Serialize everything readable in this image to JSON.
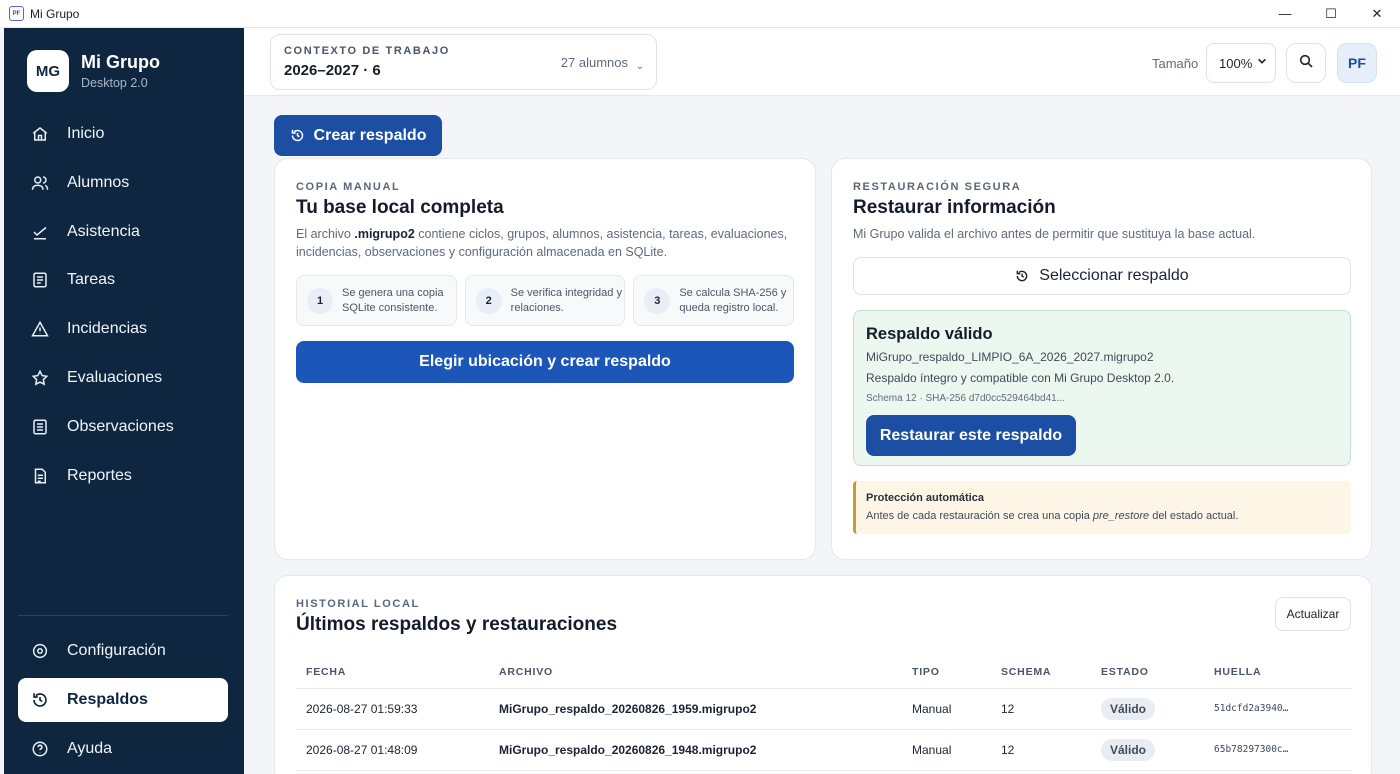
{
  "window": {
    "title": "Mi Grupo",
    "app_icon": "PF",
    "minimize": "—",
    "maximize": "☐",
    "close": "✕"
  },
  "brand": {
    "logo": "MG",
    "name": "Mi Grupo",
    "version": "Desktop 2.0"
  },
  "sidebar": {
    "items": [
      {
        "label": "Inicio",
        "icon": "home-icon"
      },
      {
        "label": "Alumnos",
        "icon": "users-icon"
      },
      {
        "label": "Asistencia",
        "icon": "check-icon"
      },
      {
        "label": "Tareas",
        "icon": "list-icon"
      },
      {
        "label": "Incidencias",
        "icon": "warning-icon"
      },
      {
        "label": "Evaluaciones",
        "icon": "star-icon"
      },
      {
        "label": "Observaciones",
        "icon": "notes-icon"
      },
      {
        "label": "Reportes",
        "icon": "report-icon"
      }
    ],
    "bottom": [
      {
        "label": "Configuración",
        "icon": "gear-icon"
      },
      {
        "label": "Respaldos",
        "icon": "history-icon",
        "active": true
      },
      {
        "label": "Ayuda",
        "icon": "help-icon"
      }
    ]
  },
  "header": {
    "context_label": "CONTEXTO DE TRABAJO",
    "context_value": "2026–2027 · 6",
    "students_count": "27 alumnos",
    "size_label": "Tamaño",
    "size_value": "100%",
    "avatar": "PF"
  },
  "actions": {
    "create_backup": "Crear respaldo"
  },
  "manual": {
    "eyebrow": "COPIA MANUAL",
    "title": "Tu base local completa",
    "desc_prefix": "El archivo ",
    "desc_ext": ".migrupo2",
    "desc_suffix": " contiene ciclos, grupos, alumnos, asistencia, tareas, evaluaciones, incidencias, observaciones y configuración almacenada en SQLite.",
    "steps": [
      {
        "num": "1",
        "text": "Se genera una copia SQLite consistente."
      },
      {
        "num": "2",
        "text": "Se verifica integridad y relaciones."
      },
      {
        "num": "3",
        "text": "Se calcula SHA-256 y queda registro local."
      }
    ],
    "button": "Elegir ubicación y crear respaldo"
  },
  "restore": {
    "eyebrow": "RESTAURACIÓN SEGURA",
    "title": "Restaurar información",
    "desc": "Mi Grupo valida el archivo antes de permitir que sustituya la base actual.",
    "select_button": "Seleccionar respaldo",
    "valid": {
      "title": "Respaldo válido",
      "file": "MiGrupo_respaldo_LIMPIO_6A_2026_2027.migrupo2",
      "message": "Respaldo íntegro y compatible con Mi Grupo Desktop 2.0.",
      "meta": "Schema 12 · SHA-256 d7d0cc529464bd41...",
      "button": "Restaurar este respaldo"
    },
    "protection": {
      "title": "Protección automática",
      "text_prefix": "Antes de cada restauración se crea una copia ",
      "text_em": "pre_restore",
      "text_suffix": " del estado actual."
    }
  },
  "history": {
    "eyebrow": "HISTORIAL LOCAL",
    "title": "Últimos respaldos y restauraciones",
    "refresh": "Actualizar",
    "columns": [
      "FECHA",
      "ARCHIVO",
      "TIPO",
      "SCHEMA",
      "ESTADO",
      "HUELLA"
    ],
    "rows": [
      {
        "date": "2026-08-27 01:59:33",
        "file": "MiGrupo_respaldo_20260826_1959.migrupo2",
        "type": "Manual",
        "schema": "12",
        "status": "Válido",
        "hash": "51dcfd2a3940…"
      },
      {
        "date": "2026-08-27 01:48:09",
        "file": "MiGrupo_respaldo_20260826_1948.migrupo2",
        "type": "Manual",
        "schema": "12",
        "status": "Válido",
        "hash": "65b78297300c…"
      }
    ]
  }
}
